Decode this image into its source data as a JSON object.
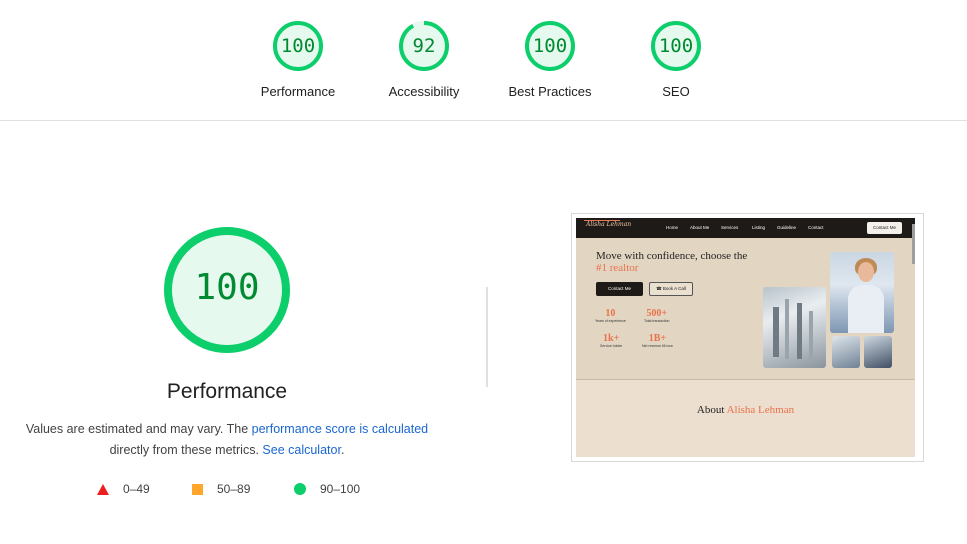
{
  "categories": [
    {
      "label": "Performance",
      "score": "100",
      "value": 100,
      "color": "#0cce6b"
    },
    {
      "label": "Accessibility",
      "score": "92",
      "value": 92,
      "color": "#0cce6b"
    },
    {
      "label": "Best Practices",
      "score": "100",
      "value": 100,
      "color": "#0cce6b"
    },
    {
      "label": "SEO",
      "score": "100",
      "value": 100,
      "color": "#0cce6b"
    }
  ],
  "main": {
    "score": "100",
    "value": 100,
    "title": "Performance",
    "desc_part1": "Values are estimated and may vary. The ",
    "desc_link1": "performance score is calculated",
    "desc_part2": "directly from these metrics. ",
    "desc_link2": "See calculator",
    "desc_part3": "."
  },
  "legend": [
    {
      "range": "0–49",
      "color": "#eb1f1f",
      "shape": "triangle"
    },
    {
      "range": "50–89",
      "color": "#ffa62b",
      "shape": "square"
    },
    {
      "range": "90–100",
      "color": "#0cce6b",
      "shape": "circle"
    }
  ],
  "thumbnail": {
    "logo": "Alisha Lehman",
    "nav": [
      "Home",
      "About Me",
      "Services",
      "Listing",
      "Guideline",
      "Contact"
    ],
    "nav_button": "Contact Me",
    "headline_1": "Move with confidence, choose the",
    "headline_2": "#1 realtor",
    "btn_primary": "Contact Me",
    "btn_secondary": "Book A Call",
    "stats": [
      {
        "num": "10",
        "label": "Years of experience"
      },
      {
        "num": "500+",
        "label": "Total transaction"
      },
      {
        "num": "1k+",
        "label": "Service holder"
      },
      {
        "num": "1B+",
        "label": "Net revenue till now"
      }
    ],
    "about_prefix": "About ",
    "about_name": "Alisha Lehman"
  }
}
